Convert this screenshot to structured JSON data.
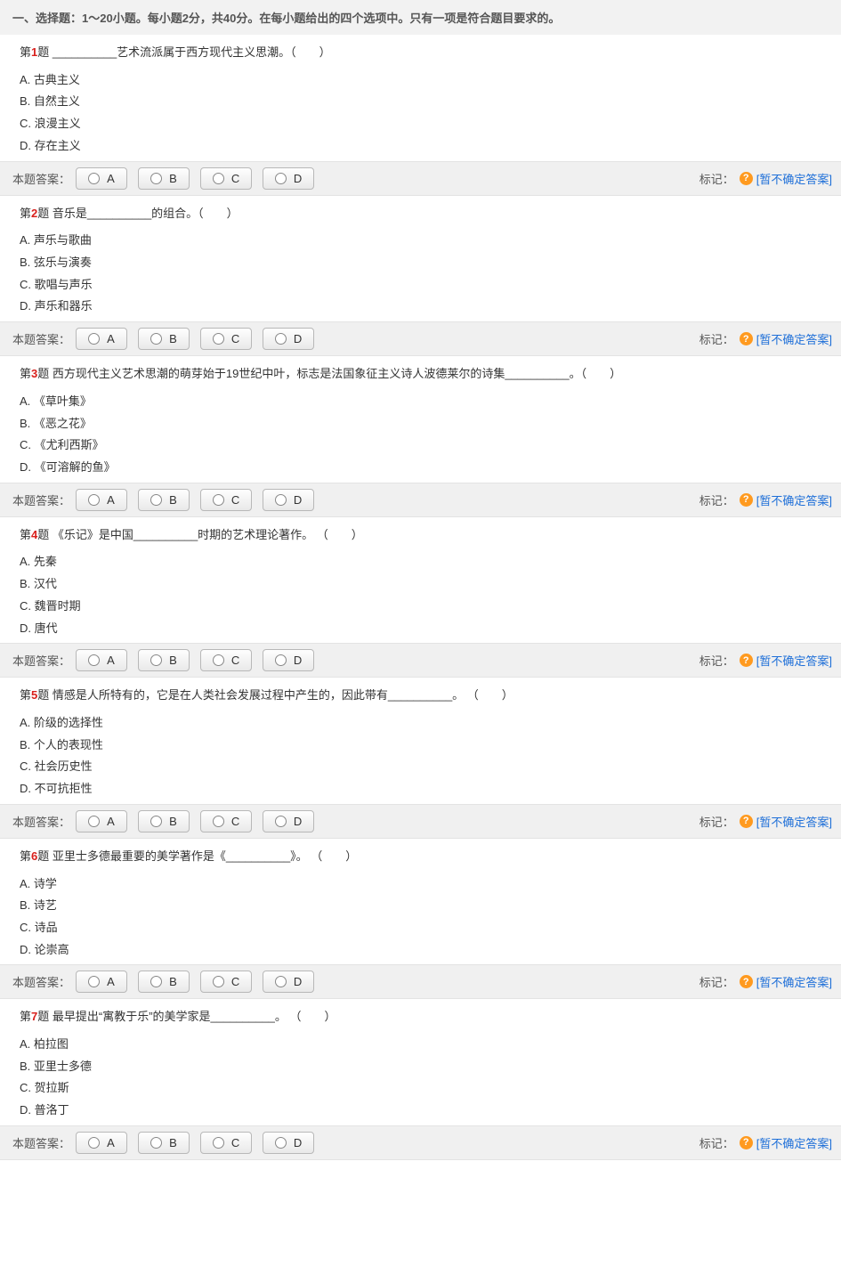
{
  "section_title": "一、选择题：1～20小题。每小题2分，共40分。在每小题给出的四个选项中。只有一项是符合题目要求的。",
  "answer_label": "本题答案：",
  "mark_label": "标记：",
  "help_symbol": "?",
  "unsure_text": "[暂不确定答案]",
  "btn_A": "A",
  "btn_B": "B",
  "btn_C": "C",
  "btn_D": "D",
  "questions": [
    {
      "num": "1",
      "prefix": "第",
      "suffix": "题",
      "text": "  __________艺术流派属于西方现代主义思潮。（　　）",
      "opts": [
        "A. 古典主义",
        "B. 自然主义",
        "C. 浪漫主义",
        "D. 存在主义"
      ]
    },
    {
      "num": "2",
      "prefix": "第",
      "suffix": "题",
      "text": "  音乐是__________的组合。（　　）",
      "opts": [
        "A. 声乐与歌曲",
        "B. 弦乐与演奏",
        "C. 歌唱与声乐",
        "D. 声乐和器乐"
      ]
    },
    {
      "num": "3",
      "prefix": "第",
      "suffix": "题",
      "text": "  西方现代主义艺术思潮的萌芽始于19世纪中叶，标志是法国象征主义诗人波德莱尔的诗集__________。（　　）",
      "opts": [
        "A. 《草叶集》",
        "B. 《恶之花》",
        "C. 《尤利西斯》",
        "D. 《可溶解的鱼》"
      ]
    },
    {
      "num": "4",
      "prefix": "第",
      "suffix": "题",
      "text": "  《乐记》是中国__________时期的艺术理论著作。 （　　）",
      "opts": [
        "A. 先秦",
        "B. 汉代",
        "C. 魏晋时期",
        "D. 唐代"
      ]
    },
    {
      "num": "5",
      "prefix": "第",
      "suffix": "题",
      "text": "  情感是人所特有的，它是在人类社会发展过程中产生的，因此带有__________。 （　　）",
      "opts": [
        "A. 阶级的选择性",
        "B. 个人的表现性",
        "C. 社会历史性",
        "D. 不可抗拒性"
      ]
    },
    {
      "num": "6",
      "prefix": "第",
      "suffix": "题",
      "text": "  亚里士多德最重要的美学著作是《__________》。 （　　）",
      "opts": [
        "A. 诗学",
        "B. 诗艺",
        "C. 诗品",
        "D. 论崇高"
      ]
    },
    {
      "num": "7",
      "prefix": "第",
      "suffix": "题",
      "text": "  最早提出“寓教于乐”的美学家是__________。 （　　）",
      "opts": [
        "A. 柏拉图",
        "B. 亚里士多德",
        "C. 贺拉斯",
        "D. 普洛丁"
      ]
    }
  ]
}
